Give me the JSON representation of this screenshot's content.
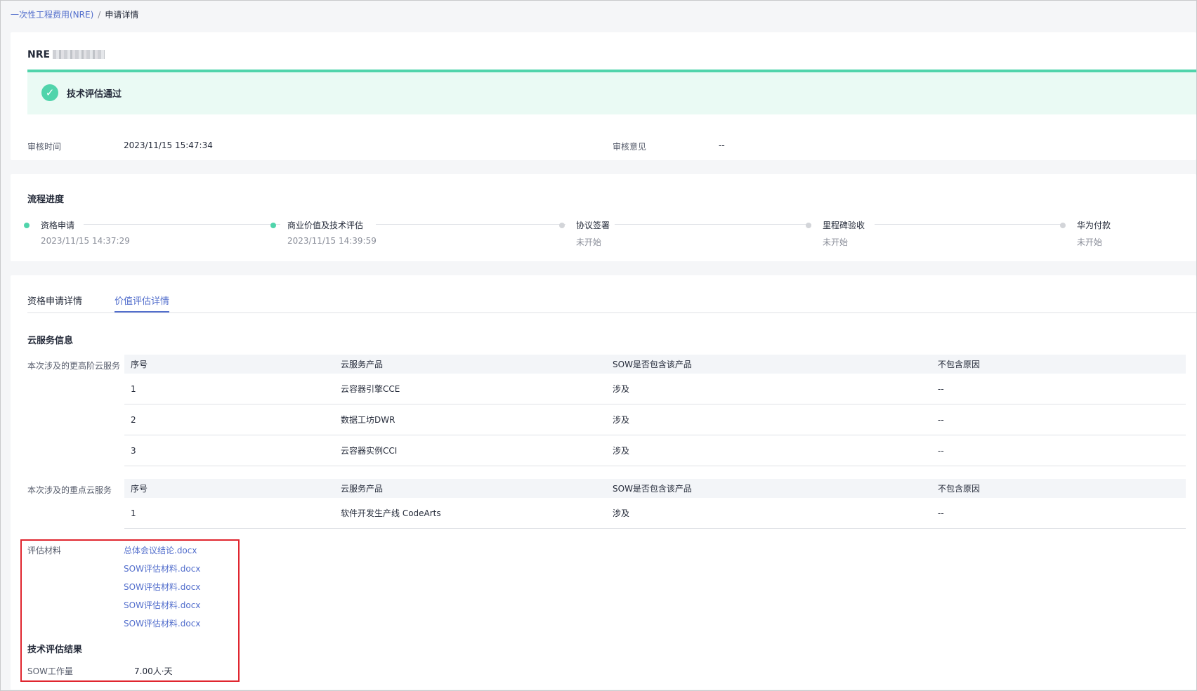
{
  "breadcrumb": {
    "root": "一次性工程费用(NRE)",
    "separator": "/",
    "current": "申请详情"
  },
  "header": {
    "title_prefix": "NRE"
  },
  "status": {
    "text": "技术评估通过",
    "icon": "check-circle-icon",
    "color": "#50d4ab"
  },
  "review": {
    "time_label": "审核时间",
    "time_value": "2023/11/15 15:47:34",
    "opinion_label": "审核意见",
    "opinion_value": "--"
  },
  "progress": {
    "title": "流程进度",
    "steps": [
      {
        "label": "资格申请",
        "time": "2023/11/15 14:37:29",
        "state": "done"
      },
      {
        "label": "商业价值及技术评估",
        "time": "2023/11/15 14:39:59",
        "state": "done"
      },
      {
        "label": "协议签署",
        "time": "未开始",
        "state": "todo"
      },
      {
        "label": "里程碑验收",
        "time": "未开始",
        "state": "todo"
      },
      {
        "label": "华为付款",
        "time": "未开始",
        "state": "todo"
      }
    ]
  },
  "tabs": [
    {
      "label": "资格申请详情",
      "active": false
    },
    {
      "label": "价值评估详情",
      "active": true
    }
  ],
  "cloud": {
    "title": "云服务信息",
    "headers": [
      "序号",
      "云服务产品",
      "SOW是否包含该产品",
      "不包含原因"
    ],
    "higher_label": "本次涉及的更高阶云服务",
    "higher_rows": [
      [
        "1",
        "云容器引擎CCE",
        "涉及",
        "--"
      ],
      [
        "2",
        "数据工坊DWR",
        "涉及",
        "--"
      ],
      [
        "3",
        "云容器实例CCI",
        "涉及",
        "--"
      ]
    ],
    "key_label": "本次涉及的重点云服务",
    "key_rows": [
      [
        "1",
        "软件开发生产线 CodeArts",
        "涉及",
        "--"
      ]
    ]
  },
  "materials": {
    "label": "评估材料",
    "files": [
      "总体会议结论.docx",
      "SOW评估材料.docx",
      "SOW评估材料.docx",
      "SOW评估材料.docx",
      "SOW评估材料.docx"
    ]
  },
  "tech_result": {
    "title": "技术评估结果",
    "workload_label": "SOW工作量",
    "workload_value": "7.00人·天"
  },
  "colors": {
    "accent": "#526ecc",
    "success": "#50d4ab",
    "highlight_box": "#e0262f"
  }
}
